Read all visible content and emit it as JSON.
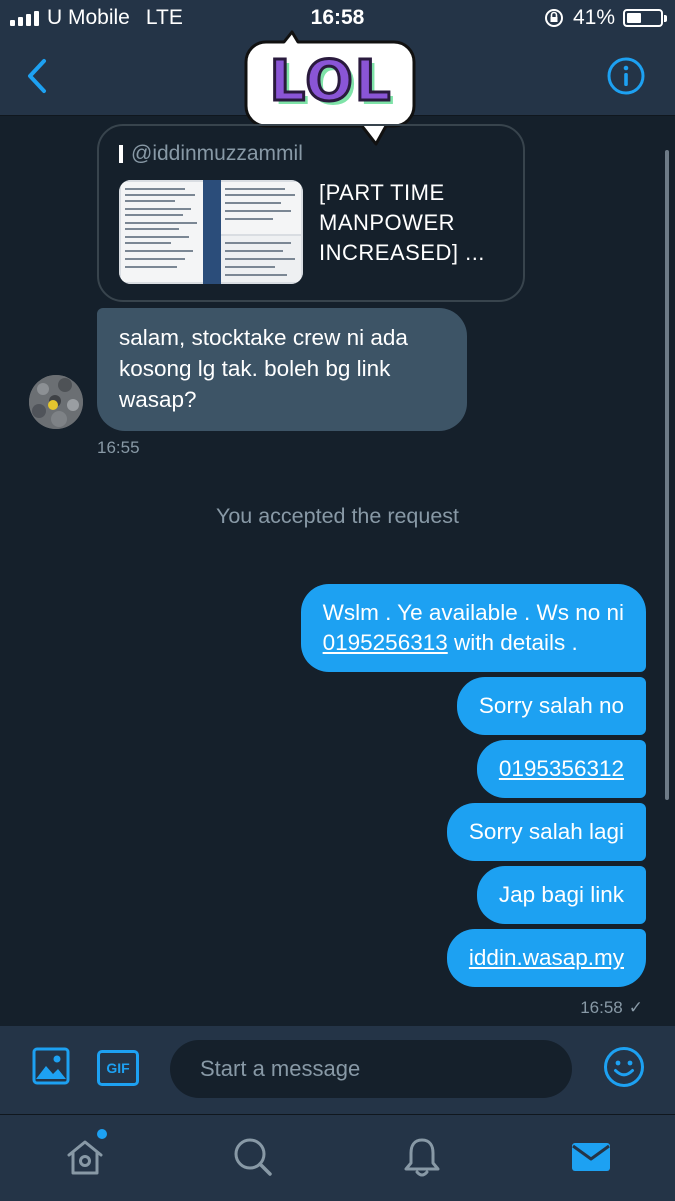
{
  "status_bar": {
    "carrier": "U Mobile",
    "network": "LTE",
    "time": "16:58",
    "battery": "41%",
    "battery_level": 0.41
  },
  "header": {
    "sticker_text": "LOL",
    "back_icon": "chevron-left-icon",
    "info_icon": "info-icon"
  },
  "conversation": {
    "quoted_tweet": {
      "handle": "@iddinmuzzammil",
      "text": "[PART TIME MANPOWER INCREASED] ..."
    },
    "incoming": {
      "text": "salam, stocktake crew ni ada kosong lg tak. boleh bg link wasap?",
      "time": "16:55"
    },
    "system_message": "You accepted the request",
    "outgoing": [
      {
        "text_before": "Wslm . Ye available . Ws no ni ",
        "link": "0195256313",
        "text_after": " with details ."
      },
      {
        "text": "Sorry salah no"
      },
      {
        "link": "0195356312"
      },
      {
        "text": "Sorry salah lagi"
      },
      {
        "text": "Jap bagi link"
      },
      {
        "link": "iddin.wasap.my"
      }
    ],
    "outgoing_time": "16:58",
    "read_receipt": "✓"
  },
  "composer": {
    "placeholder": "Start a message",
    "gif_label": "GIF"
  },
  "tab_bar": {
    "items": [
      "home-icon",
      "search-icon",
      "bell-icon",
      "mail-icon"
    ],
    "active": "mail-icon"
  },
  "colors": {
    "background": "#15202b",
    "bar": "#243447",
    "accent": "#1da1f2",
    "incoming_bubble": "#3d5466",
    "muted_text": "#8899a6"
  }
}
